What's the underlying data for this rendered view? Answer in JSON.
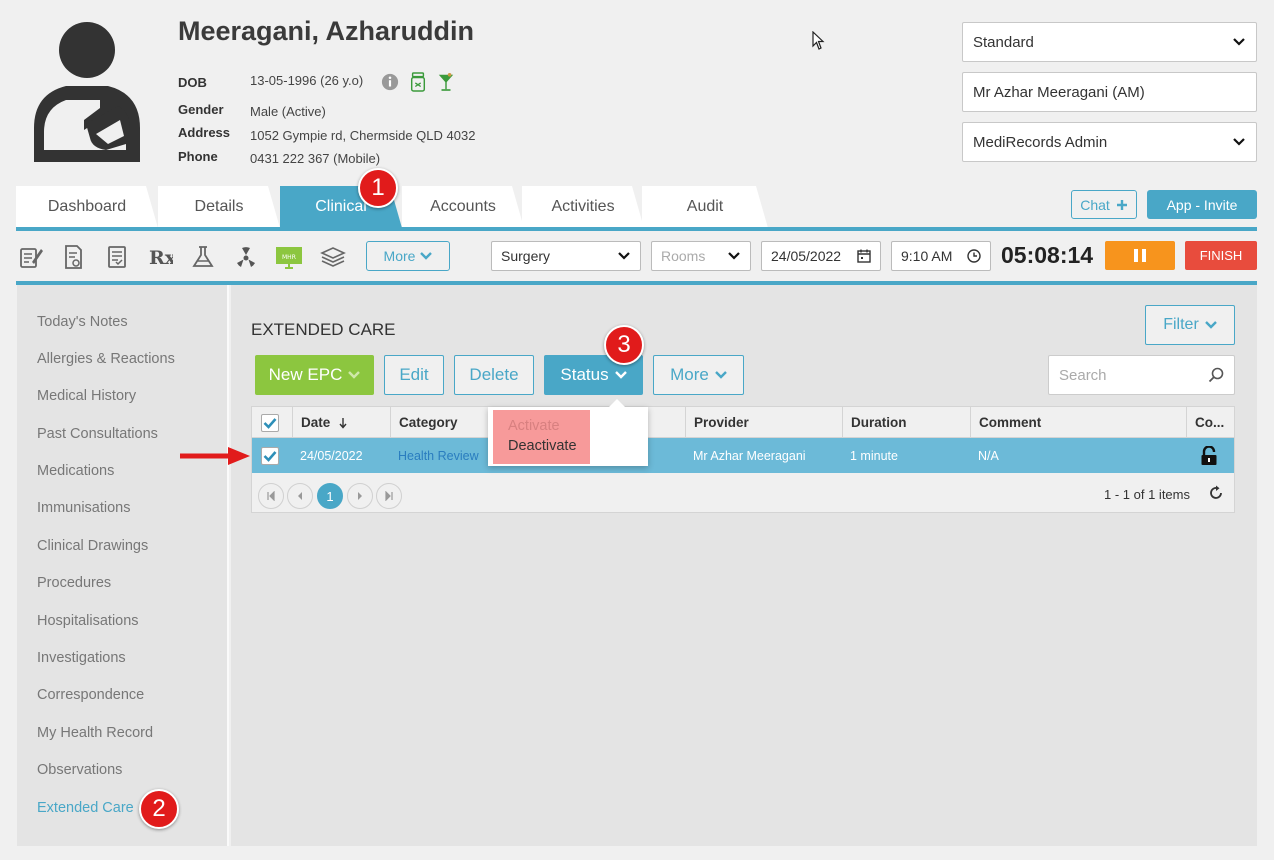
{
  "patient": {
    "name": "Meeragani, Azharuddin",
    "dob_label": "DOB",
    "dob_value": "13-05-1996 (26 y.o)",
    "gender_label": "Gender",
    "gender_value": "Male (Active)",
    "address_label": "Address",
    "address_value": "1052 Gympie rd, Chermside QLD 4032",
    "phone_label": "Phone",
    "phone_value": "0431 222 367 (Mobile)"
  },
  "header_right": {
    "template_select": "Standard",
    "practitioner": "Mr Azhar Meeragani (AM)",
    "account_select": "MediRecords Admin"
  },
  "tabs": [
    "Dashboard",
    "Details",
    "Clinical",
    "Accounts",
    "Activities",
    "Audit"
  ],
  "active_tab": "Clinical",
  "chat_label": "Chat",
  "invite_label": "App - Invite",
  "toolbar": {
    "more_label": "More",
    "location": "Surgery",
    "rooms_placeholder": "Rooms",
    "date": "24/05/2022",
    "time": "9:10 AM",
    "timer": "05:08:14",
    "finish_label": "FINISH",
    "mhr_label": "MHR"
  },
  "sidebar": [
    "Today's Notes",
    "Allergies & Reactions",
    "Medical History",
    "Past Consultations",
    "Medications",
    "Immunisations",
    "Clinical Drawings",
    "Procedures",
    "Hospitalisations",
    "Investigations",
    "Correspondence",
    "My Health Record",
    "Observations",
    "Extended Care"
  ],
  "active_sidebar": "Extended Care",
  "main": {
    "title": "EXTENDED CARE",
    "filter_label": "Filter",
    "new_label": "New EPC",
    "edit_label": "Edit",
    "delete_label": "Delete",
    "status_label": "Status",
    "more_label": "More",
    "search_placeholder": "Search"
  },
  "grid": {
    "columns": [
      "Date",
      "Category",
      "Provider",
      "Duration",
      "Comment",
      "Co..."
    ],
    "rows": [
      {
        "date": "24/05/2022",
        "category": "Health Review",
        "provider": "Mr Azhar Meeragani",
        "duration": "1 minute",
        "comment": "N/A",
        "selected": true
      }
    ],
    "current_page": "1",
    "pager_info": "1 - 1 of 1 items"
  },
  "status_menu": {
    "items": [
      "Activate",
      "Deactivate"
    ]
  },
  "callouts": [
    "1",
    "2",
    "3"
  ],
  "colors": {
    "accent": "#49a7c7",
    "new_button": "#8cc63f",
    "pause": "#f7941d",
    "finish": "#e84c3d",
    "callout": "#e11b1b",
    "menu_highlight": "#f79a9a"
  }
}
